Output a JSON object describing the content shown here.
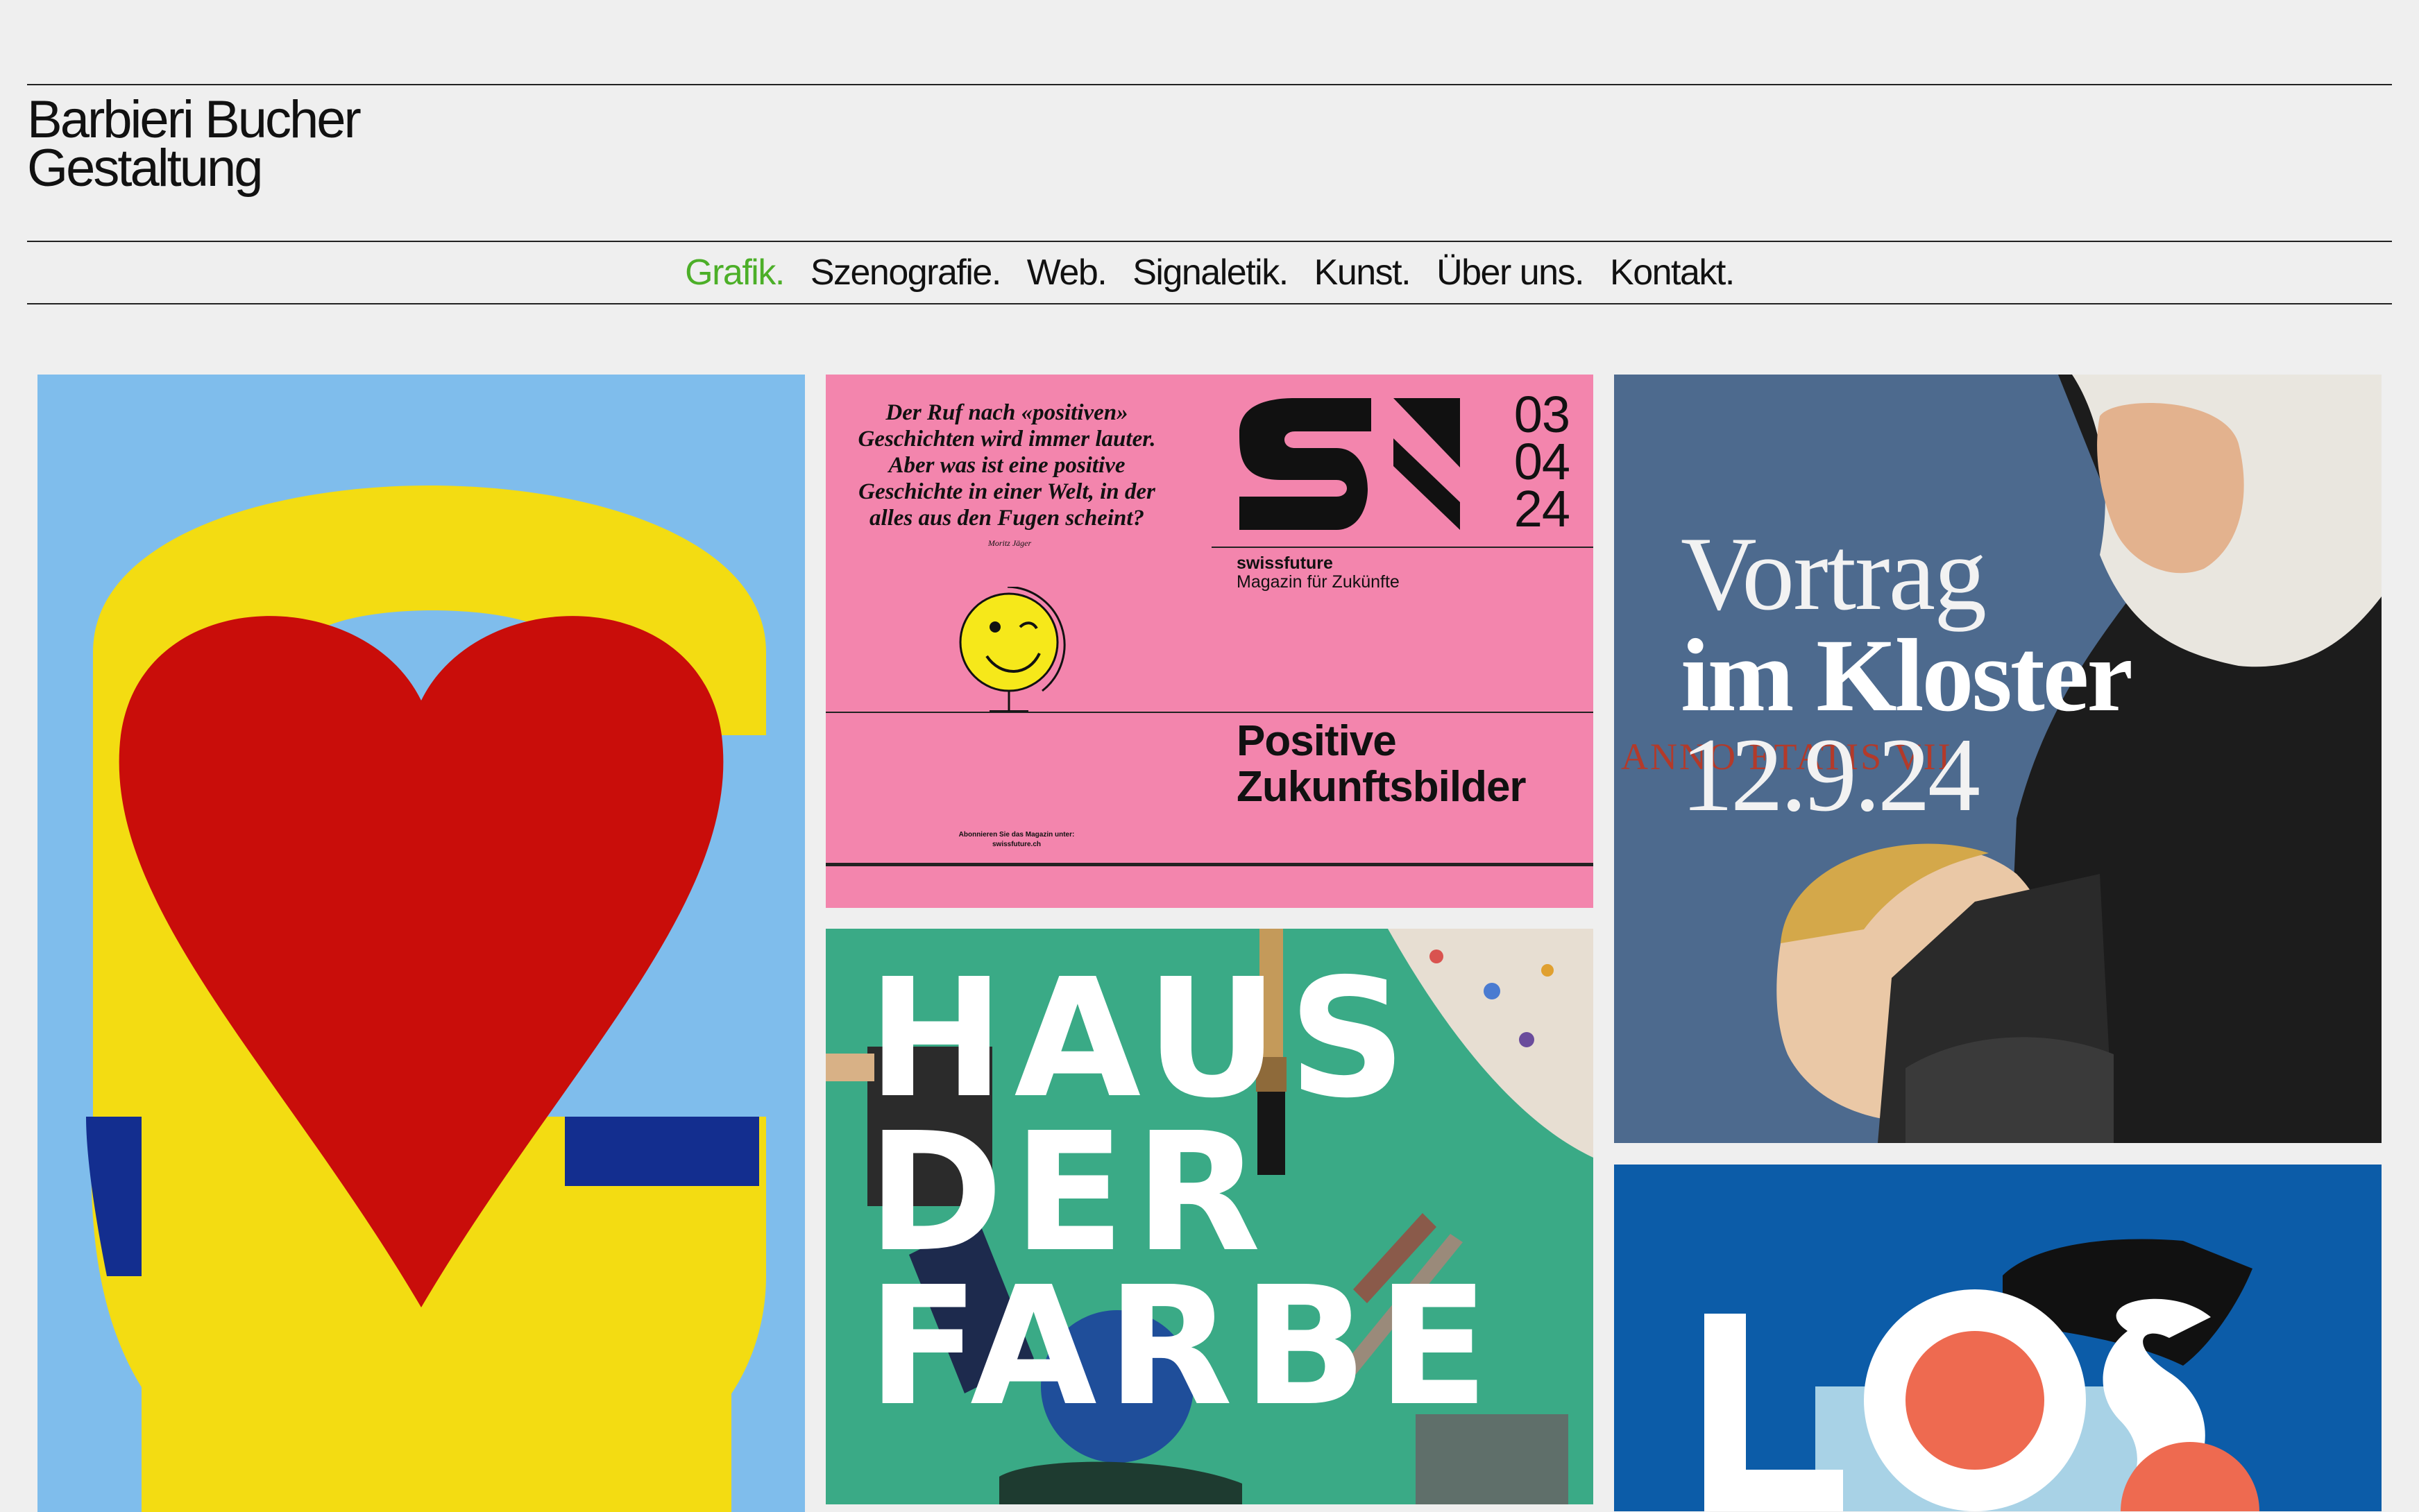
{
  "brand": {
    "line1": "Barbieri Bucher",
    "line2": "Gestaltung"
  },
  "nav": {
    "items": [
      {
        "label": "Grafik.",
        "active": true
      },
      {
        "label": "Szenografie.",
        "active": false
      },
      {
        "label": "Web.",
        "active": false
      },
      {
        "label": "Signaletik.",
        "active": false
      },
      {
        "label": "Kunst.",
        "active": false
      },
      {
        "label": "Über uns.",
        "active": false
      },
      {
        "label": "Kontakt.",
        "active": false
      }
    ],
    "active_color": "#4caf28"
  },
  "projects": {
    "swissfuture": {
      "quote": "Der Ruf nach «positiven» Geschichten wird immer lauter. Aber was ist eine positive Geschichte in einer Welt, in der alles aus den Fugen scheint?",
      "author": "Moritz Jäger",
      "dates": [
        "03",
        "04",
        "24"
      ],
      "name": "swissfuture",
      "subtitle": "Magazin für Zukünfte",
      "title_line1": "Positive",
      "title_line2": "Zukunftsbilder",
      "subscribe_line1": "Abonnieren Sie das Magazin unter:",
      "subscribe_line2": "swissfuture.ch"
    },
    "haus_der_farbe": {
      "line1": "HAUS",
      "line2": "DER",
      "line3": "FARBE"
    },
    "vortrag": {
      "line1": "Vortrag",
      "line2": "im Kloster",
      "line3": "12.9.24",
      "inscription": "ANNO ETATIS VII"
    },
    "los": {
      "text": "LOS"
    }
  },
  "colors": {
    "background": "#efefef",
    "tile_s_bg": "#7fbdec",
    "tile_s_yellow": "#f3dc12",
    "tile_s_heart": "#c90d0a",
    "tile_s_blue": "#132e8f",
    "swissfuture_pink": "#f385ad",
    "haus_green": "#3aaa86",
    "vortrag_blue": "#4d6a8e",
    "los_blue": "#0c5ca8",
    "los_red": "#ee6a50"
  }
}
